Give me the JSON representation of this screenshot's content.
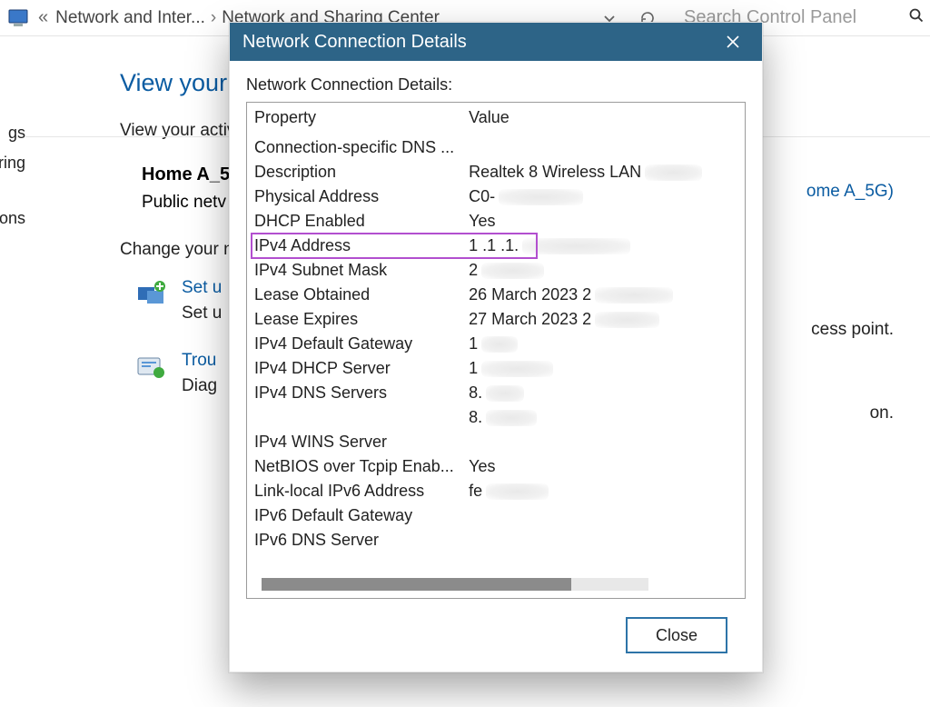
{
  "addressbar": {
    "back_chevrons": "«",
    "crumb1": "Network and Inter...",
    "chev": "›",
    "crumb2": "Network and Sharing Center",
    "search_placeholder": "Search Control Panel"
  },
  "sidebar": {
    "items": [
      "gs",
      "ring",
      "ons"
    ]
  },
  "main": {
    "heading": "View your",
    "sub1": "View your activ",
    "network_name": "Home A_5",
    "network_type": "Public netv",
    "section2": "Change your n",
    "link1_title": "Set u",
    "link1_desc": "Set u",
    "link2_title": "Trou",
    "link2_desc": "Diag",
    "right_link": "ome A_5G)",
    "right_plain1": "cess point.",
    "right_plain2": "on."
  },
  "dialog": {
    "title": "Network Connection Details",
    "body_label": "Network Connection Details:",
    "col_prop": "Property",
    "col_val": "Value",
    "rows": [
      {
        "prop": "Connection-specific DNS ...",
        "val": ""
      },
      {
        "prop": "Description",
        "val": "Realtek 8             Wireless LAN"
      },
      {
        "prop": "Physical Address",
        "val": "C0-"
      },
      {
        "prop": "DHCP Enabled",
        "val": "Yes"
      },
      {
        "prop": "IPv4 Address",
        "val": "1    .1   .1."
      },
      {
        "prop": "IPv4 Subnet Mask",
        "val": "2"
      },
      {
        "prop": "Lease Obtained",
        "val": "26 March 2023 2"
      },
      {
        "prop": "Lease Expires",
        "val": "27 March 2023 2"
      },
      {
        "prop": "IPv4 Default Gateway",
        "val": "1"
      },
      {
        "prop": "IPv4 DHCP Server",
        "val": "1"
      },
      {
        "prop": "IPv4 DNS Servers",
        "val": "8."
      },
      {
        "prop": "",
        "val": "8."
      },
      {
        "prop": "IPv4 WINS Server",
        "val": ""
      },
      {
        "prop": "NetBIOS over Tcpip Enab...",
        "val": "Yes"
      },
      {
        "prop": "Link-local IPv6 Address",
        "val": "fe"
      },
      {
        "prop": "IPv6 Default Gateway",
        "val": ""
      },
      {
        "prop": "IPv6 DNS Server",
        "val": ""
      }
    ],
    "highlight_row_index": 4,
    "close_button": "Close"
  }
}
